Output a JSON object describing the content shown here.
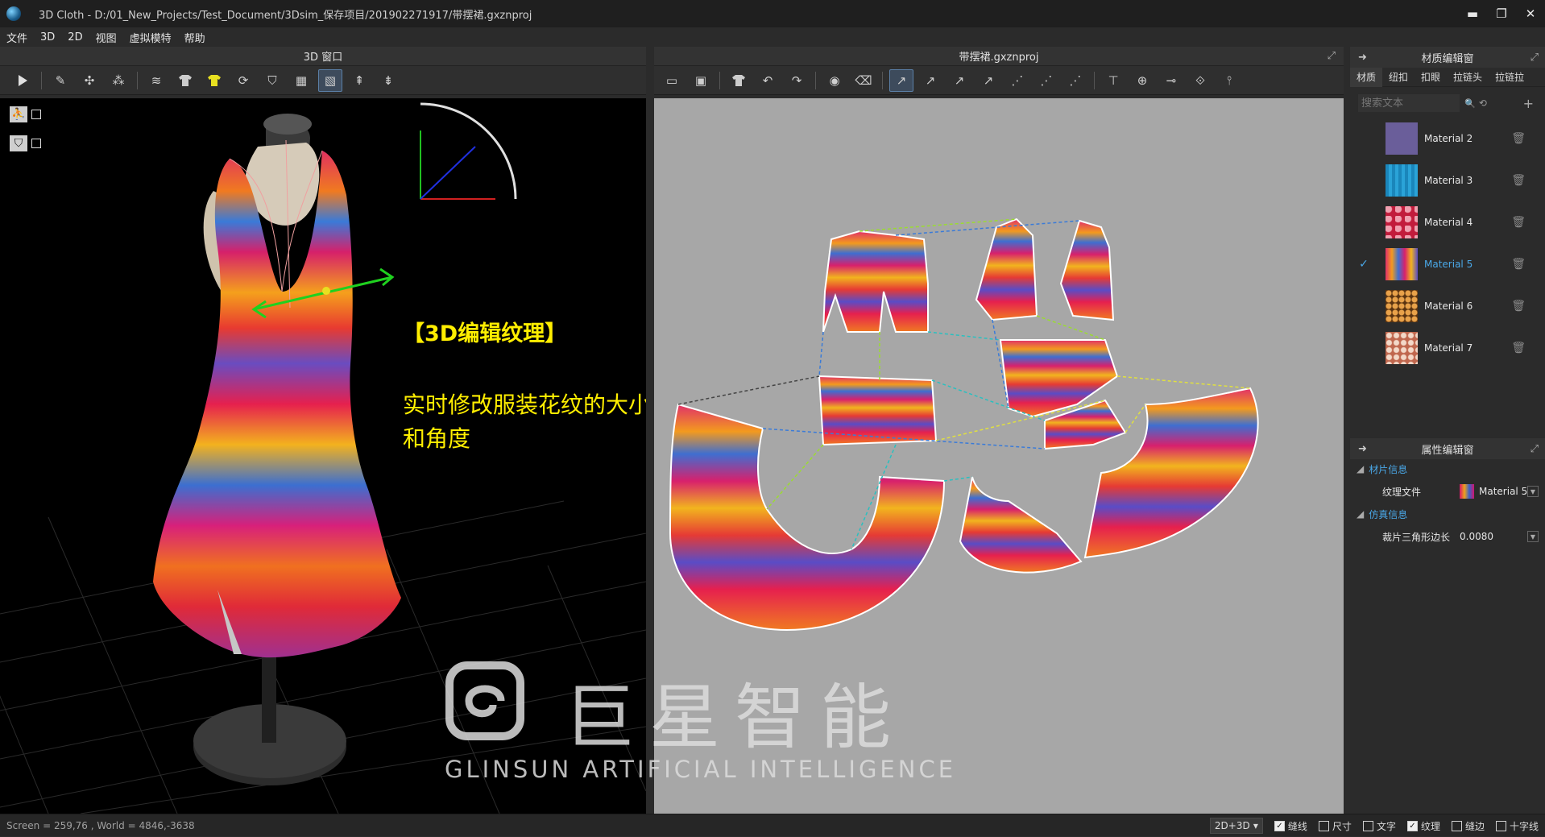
{
  "window": {
    "title": "3D Cloth - D:/01_New_Projects/Test_Document/3Dsim_保存项目/201902271917/带摆裙.gxznproj",
    "minimize": "▬",
    "restore": "❐",
    "close": "✕"
  },
  "menu": [
    "文件",
    "3D",
    "2D",
    "视图",
    "虚拟模特",
    "帮助"
  ],
  "panel3d": {
    "title": "3D 窗口",
    "toolbar_icons": [
      "play-icon",
      "pencil-icon",
      "move-points-icon",
      "scatter-points-icon",
      "wind-icon",
      "shirt-icon",
      "shirt-yellow-icon",
      "refresh-icon",
      "cup-icon",
      "grid-shirt-icon",
      "texture-icon",
      "pin-icon",
      "pin-stack-icon"
    ],
    "side_tools": [
      "figure-icon",
      "garment-icon"
    ],
    "overlay_title": "【3D编辑纹理】",
    "overlay_text": "实时修改服装花纹的大小和角度"
  },
  "panel2d": {
    "title": "带摆裙.gxznproj",
    "popout": "⤢",
    "toolbar_icons": [
      "folder-icon",
      "save-icon",
      "shirt-icon",
      "undo-icon",
      "redo-icon",
      "camera-icon",
      "trash-icon",
      "edit-point-icon",
      "add-point-icon",
      "curve-point-icon",
      "split-icon",
      "seam-icon",
      "seam-free-icon",
      "seam-check-icon",
      "align-icon",
      "crosshair-icon",
      "line-icon",
      "symmetry-icon",
      "pin-icon"
    ]
  },
  "watermark": {
    "cn": "巨星智能",
    "en": "GLINSUN  ARTIFICIAL INTELLIGENCE"
  },
  "material_panel": {
    "title": "材质编辑窗",
    "tabs": [
      "材质",
      "纽扣",
      "扣眼",
      "拉链头",
      "拉链拉"
    ],
    "search_placeholder": "搜索文本",
    "search_icon": "🔍",
    "reset_icon": "⟲",
    "add_icon": "+",
    "items": [
      {
        "label": "Material 2",
        "selected": false,
        "color": "#6a5e9a"
      },
      {
        "label": "Material 3",
        "selected": false,
        "color": "#1f8fc0"
      },
      {
        "label": "Material 4",
        "selected": false,
        "color": "#c21c3c"
      },
      {
        "label": "Material 5",
        "selected": true,
        "color": "#c4246a"
      },
      {
        "label": "Material 6",
        "selected": false,
        "color": "#9a5e1c"
      },
      {
        "label": "Material 7",
        "selected": false,
        "color": "#c0674e"
      }
    ],
    "check": "✓",
    "delete_icon": "🗑"
  },
  "property_panel": {
    "title": "属性编辑窗",
    "groups": [
      {
        "label": "材片信息",
        "rows": [
          {
            "label": "纹理文件",
            "value": "Material 5"
          }
        ]
      },
      {
        "label": "仿真信息",
        "rows": [
          {
            "label": "裁片三角形边长",
            "value": "0.0080"
          }
        ]
      }
    ]
  },
  "status": {
    "coords": "Screen = 259,76 , World = 4846,-3638",
    "mode": "2D+3D",
    "checks": [
      {
        "label": "缝线",
        "on": true
      },
      {
        "label": "尺寸",
        "on": false
      },
      {
        "label": "文字",
        "on": false
      },
      {
        "label": "纹理",
        "on": true
      },
      {
        "label": "缝边",
        "on": false
      },
      {
        "label": "十字线",
        "on": false
      }
    ]
  }
}
